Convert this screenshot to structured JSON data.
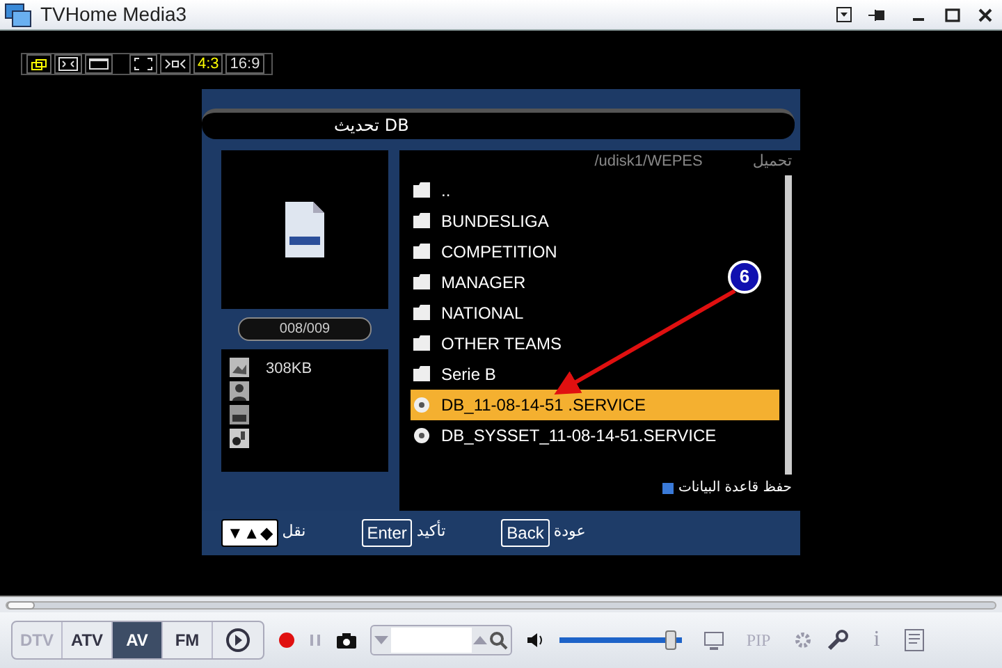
{
  "window": {
    "title": "TVHome Media3"
  },
  "view_toolbar": {
    "aspect_buttons": [
      {
        "label": "4:3",
        "selected": true
      },
      {
        "label": "16:9",
        "selected": false
      }
    ]
  },
  "tv_menu": {
    "title": "تحديث DB",
    "path": "/udisk1/WEPES",
    "header_label": "تحميل",
    "counter": "008/009",
    "file_size": "308KB",
    "items": [
      {
        "kind": "folder",
        "label": "..",
        "selected": false
      },
      {
        "kind": "folder",
        "label": "BUNDESLIGA",
        "selected": false
      },
      {
        "kind": "folder",
        "label": "COMPETITION",
        "selected": false
      },
      {
        "kind": "folder",
        "label": "MANAGER",
        "selected": false
      },
      {
        "kind": "folder",
        "label": "NATIONAL",
        "selected": false
      },
      {
        "kind": "folder",
        "label": "OTHER TEAMS",
        "selected": false
      },
      {
        "kind": "folder",
        "label": "Serie B",
        "selected": false
      },
      {
        "kind": "file",
        "label": "DB_11-08-14-51 .SERVICE",
        "selected": true
      },
      {
        "kind": "file",
        "label": "DB_SYSSET_11-08-14-51.SERVICE",
        "selected": false
      }
    ],
    "legend": "حفظ قاعدة البيانات",
    "keys": {
      "move": {
        "kind": "symbol",
        "key": "▼▲◆",
        "label": "نقل"
      },
      "confirm": {
        "kind": "word",
        "key": "Enter",
        "label": "تأكيد"
      },
      "back": {
        "kind": "word",
        "key": "Back",
        "label": "عودة"
      }
    }
  },
  "annotation": {
    "number": "6"
  },
  "controls": {
    "seek": {
      "level": 0
    },
    "sources": [
      {
        "label": "DTV",
        "disabled": true,
        "selected": false
      },
      {
        "label": "ATV",
        "disabled": false,
        "selected": false
      },
      {
        "label": "AV",
        "disabled": false,
        "selected": true
      },
      {
        "label": "FM",
        "disabled": false,
        "selected": false
      }
    ],
    "volume": {
      "level": 0.95
    },
    "pip_label": "PIP",
    "info_label": "i"
  }
}
